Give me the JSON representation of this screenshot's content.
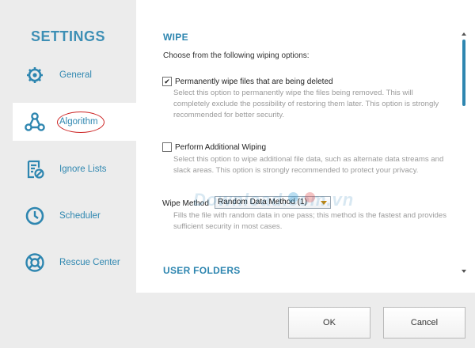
{
  "sidebar": {
    "title": "SETTINGS",
    "items": [
      {
        "label": "General",
        "icon": "gear-icon"
      },
      {
        "label": "Algorithm",
        "icon": "algorithm-nodes-icon"
      },
      {
        "label": "Ignore Lists",
        "icon": "ignore-list-icon"
      },
      {
        "label": "Scheduler",
        "icon": "clock-icon"
      },
      {
        "label": "Rescue Center",
        "icon": "lifebuoy-icon"
      }
    ],
    "active_index": 1
  },
  "main": {
    "section_title": "WIPE",
    "intro": "Choose from the following wiping options:",
    "options": [
      {
        "label": "Permanently wipe files that are being deleted",
        "checked": true,
        "description": "Select this option to permanently wipe the files being removed. This will completely exclude the possibility of restoring them later. This option is strongly recommended for better security."
      },
      {
        "label": "Perform Additional Wiping",
        "checked": false,
        "description": "Select this option to wipe additional file data, such as alternate data streams and slack areas. This option is strongly recommended to protect your privacy."
      }
    ],
    "wipe_method": {
      "label": "Wipe Method",
      "selected": "Random Data Method (1)",
      "description": "Fills the file with random data in one pass; this method is the fastest and provides sufficient security in most cases."
    },
    "next_section_title": "USER FOLDERS"
  },
  "footer": {
    "ok_label": "OK",
    "cancel_label": "Cancel"
  },
  "watermark": {
    "text": "Download.com.vn"
  },
  "colors": {
    "accent": "#2e86b0",
    "sidebar_bg": "#ececec",
    "highlight_circle": "#cc2222"
  }
}
